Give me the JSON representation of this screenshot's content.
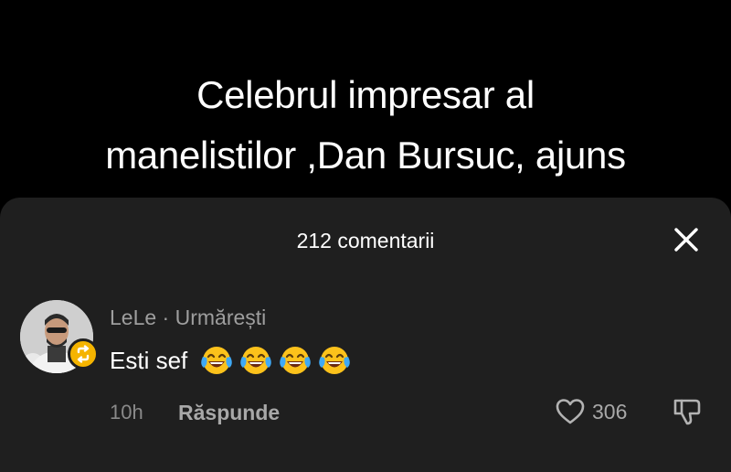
{
  "video": {
    "caption_line1": "Celebrul impresar al",
    "caption_line2": "manelistilor ,Dan Bursuc, ajuns"
  },
  "comments_sheet": {
    "title": "212 comentarii",
    "close_icon": "close-icon"
  },
  "comment": {
    "username": "LeLe · Urmărești",
    "text": "Esti sef",
    "emojis": [
      "face-with-tears-of-joy",
      "face-with-tears-of-joy",
      "face-with-tears-of-joy",
      "face-with-tears-of-joy"
    ],
    "time": "10h",
    "reply_label": "Răspunde",
    "like_count": "306"
  },
  "colors": {
    "background": "#000000",
    "sheet": "#1f1f1f",
    "badge": "#f5b400"
  }
}
